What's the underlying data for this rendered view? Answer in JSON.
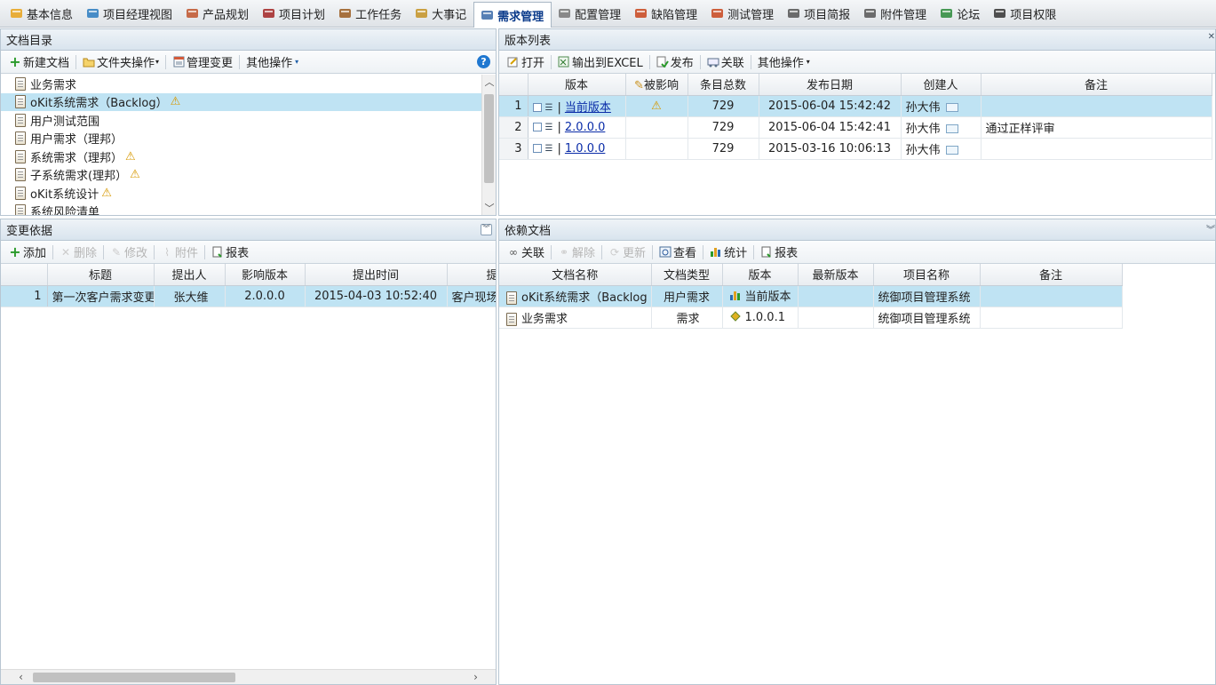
{
  "tabs": [
    {
      "label": "基本信息",
      "icon": "info-card-icon",
      "color": "#e8a21a"
    },
    {
      "label": "项目经理视图",
      "icon": "pie-chart-icon",
      "color": "#2a7bbf"
    },
    {
      "label": "产品规划",
      "icon": "hierarchy-icon",
      "color": "#c0532c"
    },
    {
      "label": "项目计划",
      "icon": "calendar-icon",
      "color": "#a22424"
    },
    {
      "label": "工作任务",
      "icon": "briefcase-icon",
      "color": "#9a5a1e"
    },
    {
      "label": "大事记",
      "icon": "book-icon",
      "color": "#c49325"
    },
    {
      "label": "需求管理",
      "icon": "magnifier-icon",
      "color": "#3a6aa8"
    },
    {
      "label": "配置管理",
      "icon": "document-list-icon",
      "color": "#777"
    },
    {
      "label": "缺陷管理",
      "icon": "bug-icon",
      "color": "#c8451c"
    },
    {
      "label": "测试管理",
      "icon": "gear-bug-icon",
      "color": "#c8451c"
    },
    {
      "label": "项目简报",
      "icon": "report-icon",
      "color": "#555"
    },
    {
      "label": "附件管理",
      "icon": "paperclip-icon",
      "color": "#555"
    },
    {
      "label": "论坛",
      "icon": "chat-icon",
      "color": "#2a8a3a"
    },
    {
      "label": "项目权限",
      "icon": "user-icon",
      "color": "#333"
    }
  ],
  "active_tab": "需求管理",
  "doc_catalog": {
    "title": "文档目录",
    "toolbar": {
      "new_doc": "新建文档",
      "folder_ops": "文件夹操作",
      "manage_change": "管理变更",
      "other_ops": "其他操作"
    },
    "nodes": [
      {
        "label": "业务需求",
        "warn": false,
        "selected": false
      },
      {
        "label": "oKit系统需求（Backlog）",
        "warn": true,
        "selected": true
      },
      {
        "label": "用户测试范围",
        "warn": false,
        "selected": false
      },
      {
        "label": "用户需求（理邦）",
        "warn": false,
        "selected": false
      },
      {
        "label": "系统需求（理邦）",
        "warn": true,
        "selected": false
      },
      {
        "label": "子系统需求(理邦）",
        "warn": true,
        "selected": false
      },
      {
        "label": "oKit系统设计",
        "warn": true,
        "selected": false
      },
      {
        "label": "系统风险清单",
        "warn": false,
        "selected": false
      }
    ]
  },
  "version_list": {
    "title": "版本列表",
    "toolbar": {
      "open": "打开",
      "export_excel": "输出到EXCEL",
      "publish": "发布",
      "link": "关联",
      "other_ops": "其他操作"
    },
    "columns": [
      "版本",
      "被影响",
      "条目总数",
      "发布日期",
      "创建人",
      "备注"
    ],
    "rows": [
      {
        "n": "1",
        "version": "当前版本",
        "affected": true,
        "count": "729",
        "date": "2015-06-04 15:42:42",
        "creator": "孙大伟",
        "note": ""
      },
      {
        "n": "2",
        "version": "2.0.0.0",
        "affected": false,
        "count": "729",
        "date": "2015-06-04 15:42:41",
        "creator": "孙大伟",
        "note": "通过正样评审"
      },
      {
        "n": "3",
        "version": "1.0.0.0",
        "affected": false,
        "count": "729",
        "date": "2015-03-16 10:06:13",
        "creator": "孙大伟",
        "note": ""
      }
    ]
  },
  "change_basis": {
    "title": "变更依据",
    "toolbar": {
      "add": "添加",
      "delete": "删除",
      "edit": "修改",
      "attach": "附件",
      "report": "报表"
    },
    "columns": [
      "标题",
      "提出人",
      "影响版本",
      "提出时间",
      "提"
    ],
    "rows": [
      {
        "n": "1",
        "title": "第一次客户需求变更",
        "proposer": "张大维",
        "version": "2.0.0.0",
        "time": "2015-04-03 10:52:40",
        "extra": "客户现场"
      }
    ]
  },
  "dependent_docs": {
    "title": "依赖文档",
    "toolbar": {
      "link": "关联",
      "unlink": "解除",
      "update": "更新",
      "view": "查看",
      "stats": "统计",
      "report": "报表"
    },
    "columns": [
      "文档名称",
      "文档类型",
      "版本",
      "最新版本",
      "项目名称",
      "备注"
    ],
    "rows": [
      {
        "name": "oKit系统需求（Backlog",
        "type": "用户需求",
        "version": "当前版本",
        "latest": "",
        "project": "统御项目管理系统",
        "note": ""
      },
      {
        "name": "业务需求",
        "type": "需求",
        "version": "1.0.0.1",
        "latest": "",
        "project": "统御项目管理系统",
        "note": ""
      }
    ]
  }
}
